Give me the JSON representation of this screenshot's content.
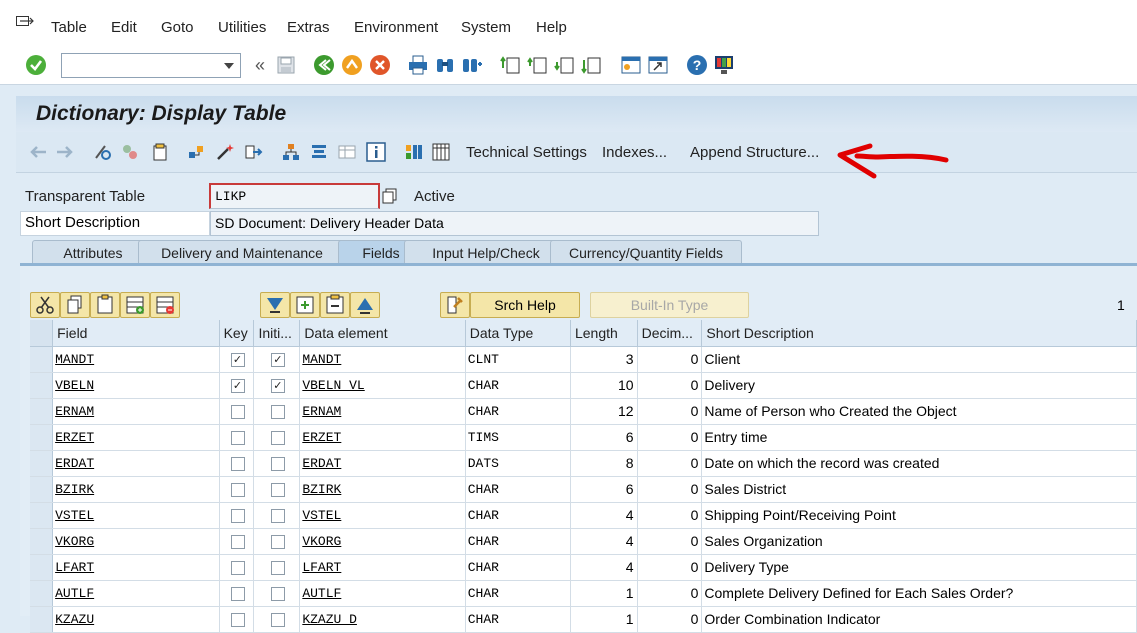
{
  "menu": {
    "items": [
      "Table",
      "Edit",
      "Goto",
      "Utilities",
      "Extras",
      "Environment",
      "System",
      "Help"
    ]
  },
  "toolbar": {
    "command_value": "",
    "icons": [
      "enter-icon",
      "back-arrows-icon",
      "save-icon",
      "back-icon",
      "exit-icon",
      "cancel-icon",
      "print-icon",
      "find-icon",
      "find-next-icon",
      "first-page-icon",
      "previous-page-icon",
      "next-page-icon",
      "last-page-icon",
      "create-session-icon",
      "shortcut-icon",
      "help-icon",
      "customize-layout-icon"
    ]
  },
  "title": "Dictionary: Display Table",
  "app_toolbar": {
    "technical_settings": "Technical Settings",
    "indexes": "Indexes...",
    "append_structure": "Append Structure..."
  },
  "header": {
    "table_type_label": "Transparent Table",
    "table_name": "LIKP",
    "status": "Active",
    "short_desc_label": "Short Description",
    "short_desc": "SD Document: Delivery Header Data"
  },
  "tabs": [
    {
      "label": "Attributes",
      "active": false
    },
    {
      "label": "Delivery and Maintenance",
      "active": false
    },
    {
      "label": "Fields",
      "active": true
    },
    {
      "label": "Input Help/Check",
      "active": false
    },
    {
      "label": "Currency/Quantity Fields",
      "active": false
    }
  ],
  "grid_toolbar": {
    "srch_help": "Srch Help",
    "builtin_type": "Built-In Type",
    "row_count": "1"
  },
  "columns": [
    "Field",
    "Key",
    "Initi...",
    "Data element",
    "Data Type",
    "Length",
    "Decim...",
    "Short Description"
  ],
  "rows": [
    {
      "field": "MANDT",
      "key": true,
      "init": true,
      "element": "MANDT",
      "type": "CLNT",
      "length": "3",
      "decim": "0",
      "desc": "Client"
    },
    {
      "field": "VBELN",
      "key": true,
      "init": true,
      "element": "VBELN_VL",
      "type": "CHAR",
      "length": "10",
      "decim": "0",
      "desc": "Delivery"
    },
    {
      "field": "ERNAM",
      "key": false,
      "init": false,
      "element": "ERNAM",
      "type": "CHAR",
      "length": "12",
      "decim": "0",
      "desc": "Name of Person who Created the Object"
    },
    {
      "field": "ERZET",
      "key": false,
      "init": false,
      "element": "ERZET",
      "type": "TIMS",
      "length": "6",
      "decim": "0",
      "desc": "Entry time"
    },
    {
      "field": "ERDAT",
      "key": false,
      "init": false,
      "element": "ERDAT",
      "type": "DATS",
      "length": "8",
      "decim": "0",
      "desc": "Date on which the record was created"
    },
    {
      "field": "BZIRK",
      "key": false,
      "init": false,
      "element": "BZIRK",
      "type": "CHAR",
      "length": "6",
      "decim": "0",
      "desc": "Sales District"
    },
    {
      "field": "VSTEL",
      "key": false,
      "init": false,
      "element": "VSTEL",
      "type": "CHAR",
      "length": "4",
      "decim": "0",
      "desc": "Shipping Point/Receiving Point"
    },
    {
      "field": "VKORG",
      "key": false,
      "init": false,
      "element": "VKORG",
      "type": "CHAR",
      "length": "4",
      "decim": "0",
      "desc": "Sales Organization"
    },
    {
      "field": "LFART",
      "key": false,
      "init": false,
      "element": "LFART",
      "type": "CHAR",
      "length": "4",
      "decim": "0",
      "desc": "Delivery Type"
    },
    {
      "field": "AUTLF",
      "key": false,
      "init": false,
      "element": "AUTLF",
      "type": "CHAR",
      "length": "1",
      "decim": "0",
      "desc": "Complete Delivery Defined for Each Sales Order?"
    },
    {
      "field": "KZAZU",
      "key": false,
      "init": false,
      "element": "KZAZU_D",
      "type": "CHAR",
      "length": "1",
      "decim": "0",
      "desc": "Order Combination Indicator"
    }
  ],
  "colors": {
    "annotation_arrow": "#e00000",
    "title_bg": "#cfe0ef",
    "tab_active": "#b9d3ea"
  }
}
